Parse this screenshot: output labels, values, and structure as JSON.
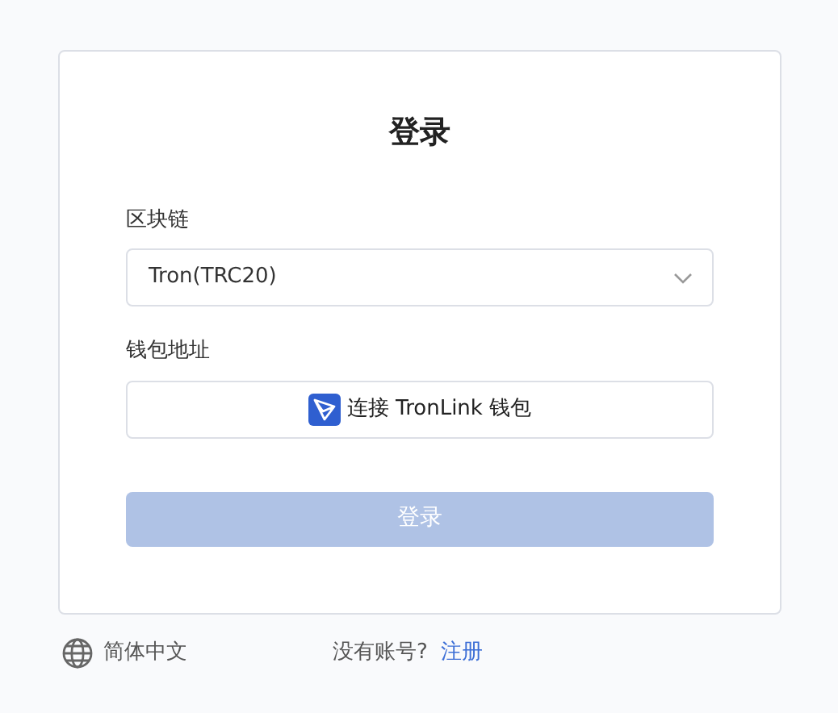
{
  "title": "登录",
  "chain": {
    "label": "区块链",
    "value": "Tron(TRC20)"
  },
  "wallet": {
    "label": "钱包地址",
    "button": "连接 TronLink 钱包"
  },
  "submit": {
    "label": "登录",
    "disabled": true
  },
  "footer": {
    "language": "简体中文",
    "prompt": "没有账号?",
    "link": "注册"
  }
}
